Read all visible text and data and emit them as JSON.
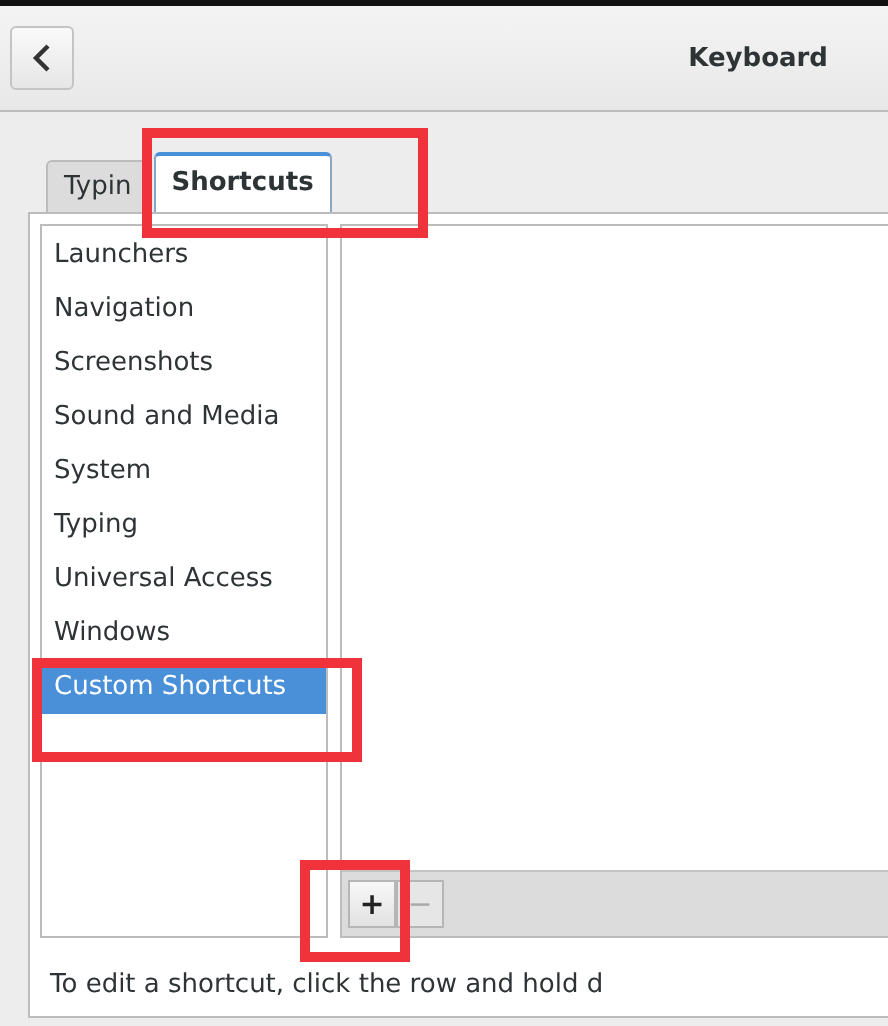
{
  "window": {
    "title": "Keyboard"
  },
  "tabs": [
    {
      "label": "Typin",
      "selected": false
    },
    {
      "label": "Shortcuts",
      "selected": true
    }
  ],
  "sections": [
    {
      "label": "Launchers",
      "selected": false
    },
    {
      "label": "Navigation",
      "selected": false
    },
    {
      "label": "Screenshots",
      "selected": false
    },
    {
      "label": "Sound and Media",
      "selected": false
    },
    {
      "label": "System",
      "selected": false
    },
    {
      "label": "Typing",
      "selected": false
    },
    {
      "label": "Universal Access",
      "selected": false
    },
    {
      "label": "Windows",
      "selected": false
    },
    {
      "label": "Custom Shortcuts",
      "selected": true
    }
  ],
  "toolbar": [
    {
      "label": "+",
      "disabled": false
    },
    {
      "label": "−",
      "disabled": true
    }
  ],
  "hint": "To edit a shortcut, click the row and hold d"
}
